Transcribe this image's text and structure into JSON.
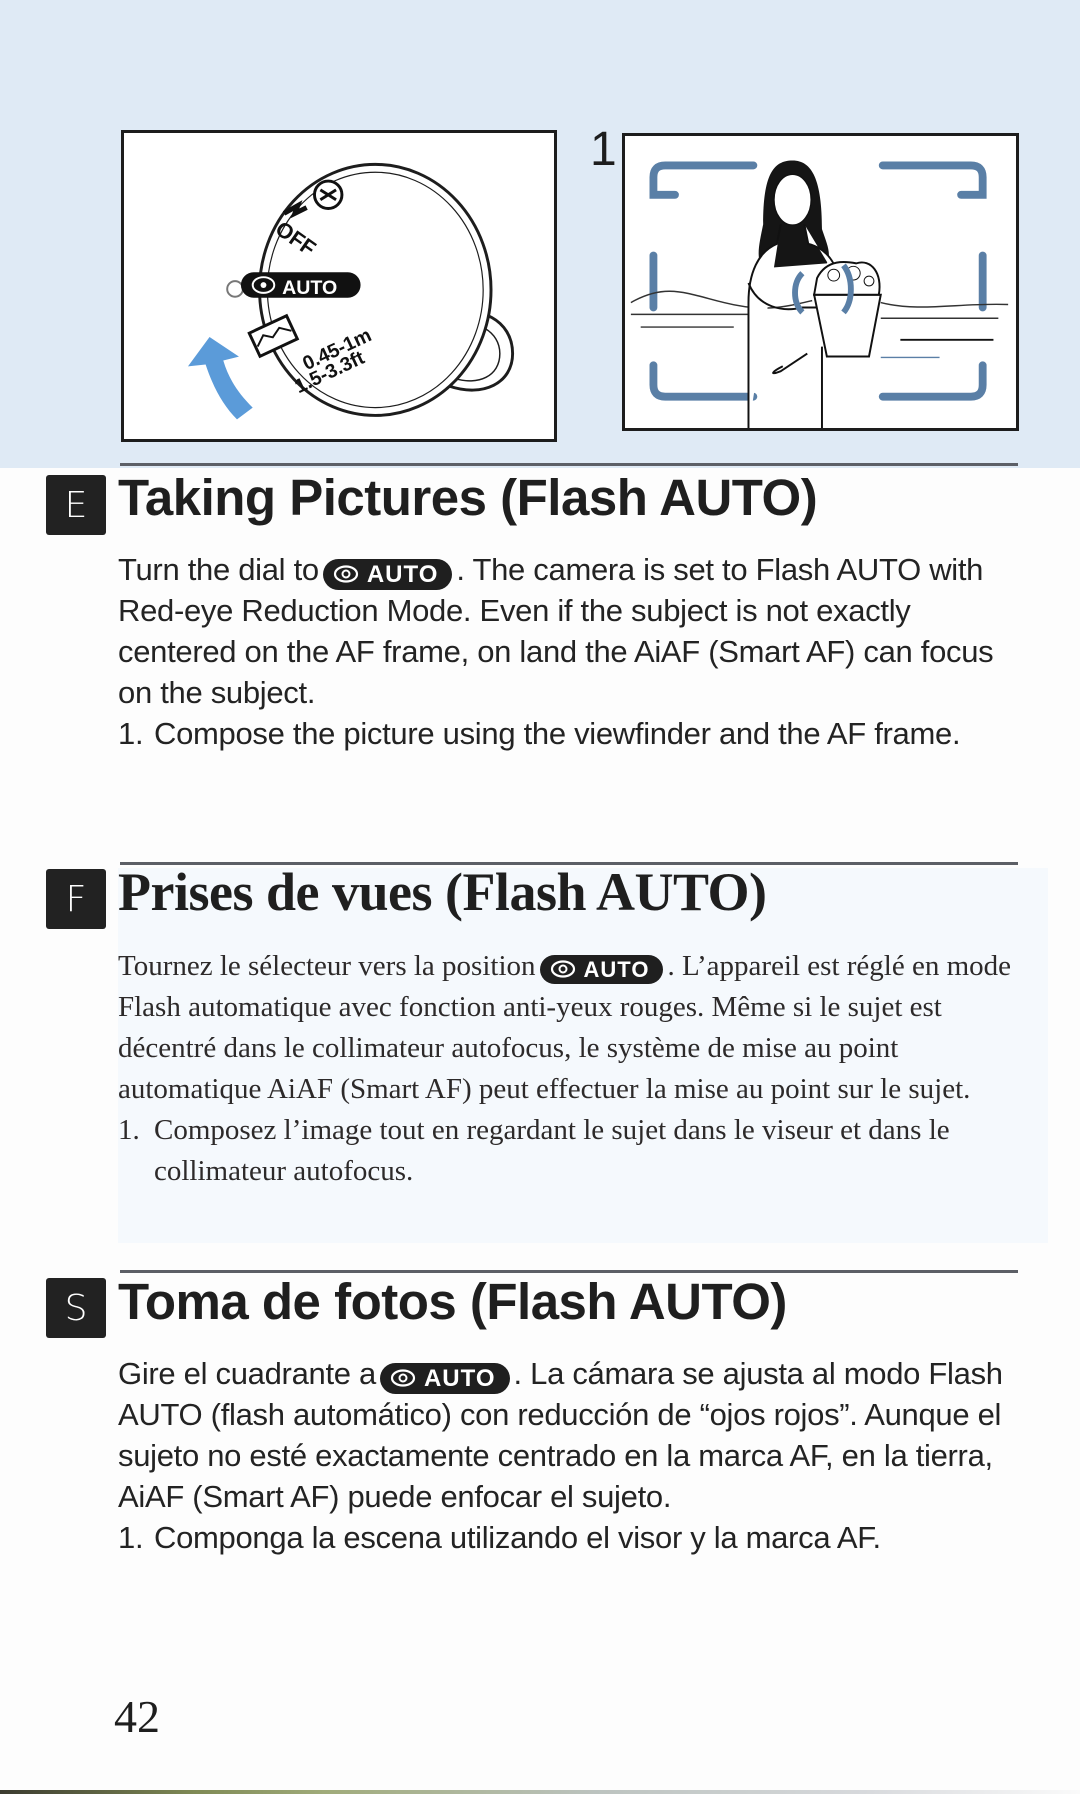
{
  "page_number": "42",
  "figures": {
    "dial": {
      "labels": [
        "OFF",
        "AUTO",
        "0.45-1m",
        "1.5-3.3ft"
      ],
      "selected_mode": "AUTO",
      "arrow_color": "#5b9bd9"
    },
    "viewfinder": {
      "step_number": "1",
      "af_frame_color": "#5a7fa6"
    }
  },
  "auto_mode_label": "AUTO",
  "sections": {
    "english": {
      "language_code": "E",
      "title": "Taking Pictures (Flash AUTO)",
      "intro_before": "Turn the dial to",
      "intro_after": ". The camera is set to Flash AUTO with Red-eye Reduction Mode. Even if the subject is not exactly centered on the AF frame, on land the AiAF (Smart AF) can focus on the subject.",
      "steps": [
        {
          "num": "1.",
          "text": "Compose the picture using the viewfinder and the AF frame."
        }
      ]
    },
    "french": {
      "language_code": "F",
      "title": "Prises de vues (Flash AUTO)",
      "intro_before": "Tournez le sélecteur vers la position",
      "intro_after": ". L’appareil est réglé en mode Flash automatique avec fonction anti-yeux rouges. Même si le sujet est décentré dans le collimateur autofocus, le système de mise au point automatique AiAF (Smart AF) peut effectuer la mise au point sur le sujet.",
      "steps": [
        {
          "num": "1.",
          "text": "Composez l’image tout en regardant le sujet dans le viseur et dans le collimateur autofocus."
        }
      ]
    },
    "spanish": {
      "language_code": "S",
      "title": "Toma de fotos (Flash AUTO)",
      "intro_before": "Gire el cuadrante a",
      "intro_after": ". La cámara se ajusta al modo Flash AUTO (flash automático) con reducción de “ojos rojos”. Aunque el sujeto no esté exactamente centrado en la marca AF, en la tierra, AiAF (Smart AF) puede enfocar el sujeto.",
      "steps": [
        {
          "num": "1.",
          "text": "Componga la escena utilizando el visor y la marca AF."
        }
      ]
    }
  }
}
